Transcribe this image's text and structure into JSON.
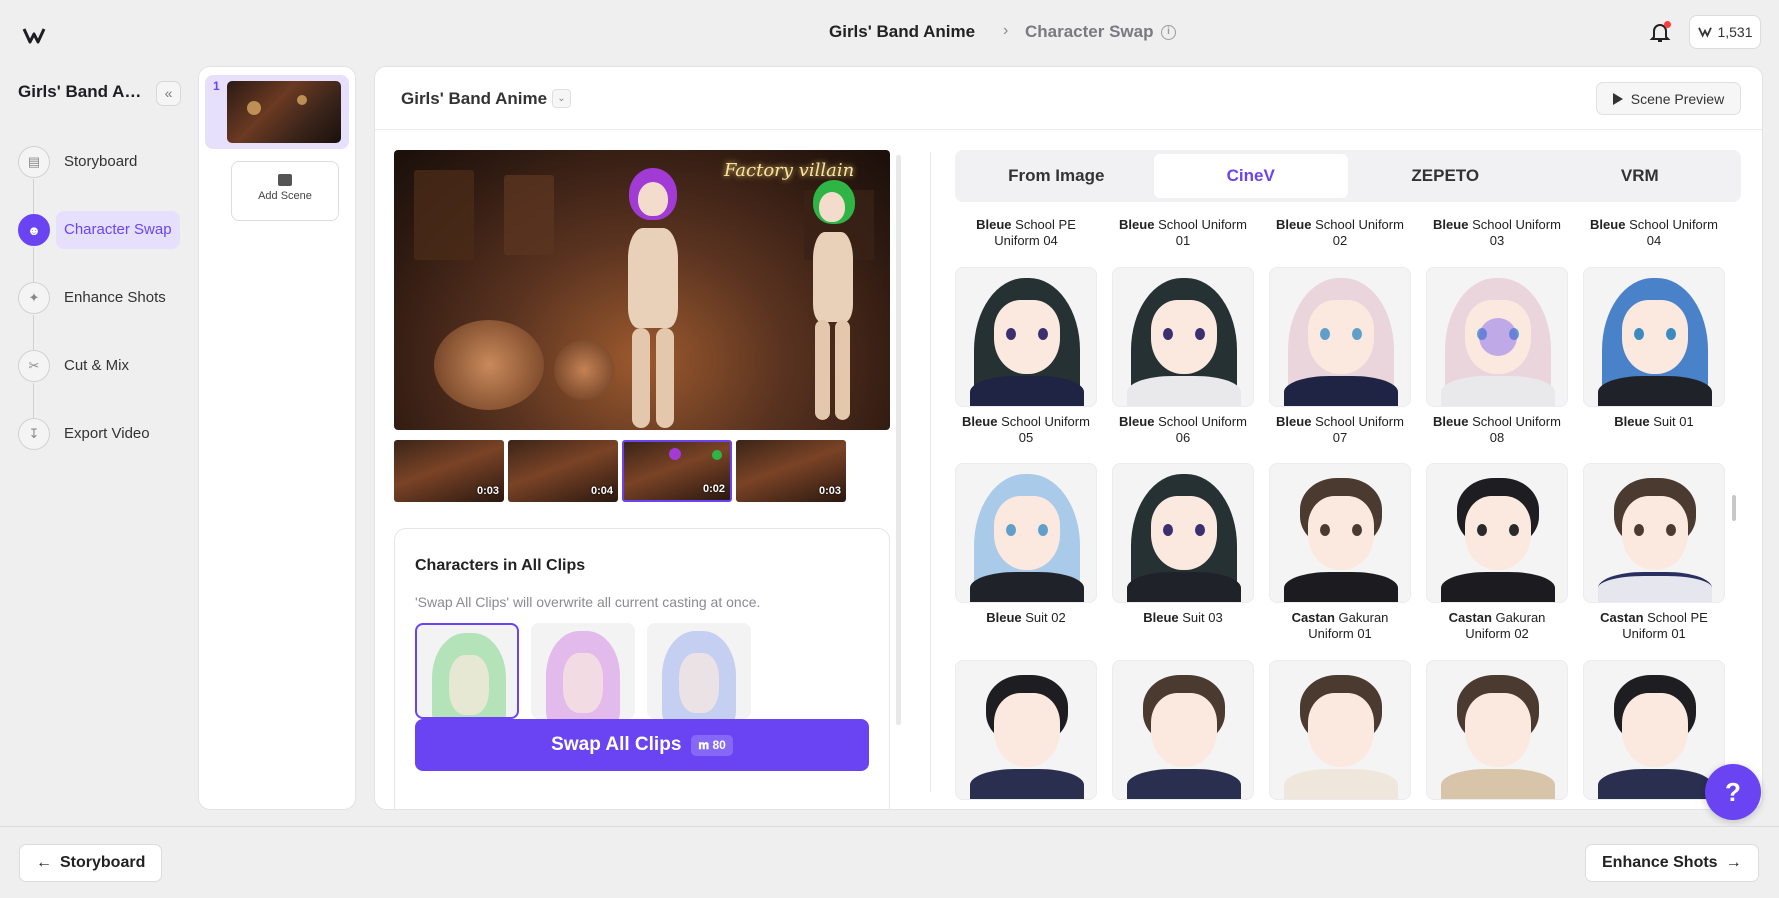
{
  "app": {
    "logo": "vivid-logo"
  },
  "header": {
    "project_title": "Girls' Band Anime",
    "separator": "›",
    "page": "Character Swap",
    "info": "i",
    "credits": "1,531"
  },
  "sidebar": {
    "project_name": "Girls' Band Ani...",
    "collapse": "«",
    "items": [
      {
        "label": "Storyboard",
        "icon": "storyboard-icon"
      },
      {
        "label": "Character Swap",
        "icon": "users-icon",
        "active": true
      },
      {
        "label": "Enhance Shots",
        "icon": "sparkle-icon"
      },
      {
        "label": "Cut & Mix",
        "icon": "scissors-icon"
      },
      {
        "label": "Export Video",
        "icon": "download-icon"
      }
    ]
  },
  "scenes": {
    "items": [
      {
        "number": "1"
      }
    ],
    "add_label": "Add Scene"
  },
  "main": {
    "title": "Girls' Band Anime",
    "dropdown": "⌄",
    "preview_label": "Scene Preview",
    "video_sign": "Factory villain",
    "clips": [
      {
        "duration": "0:03"
      },
      {
        "duration": "0:04"
      },
      {
        "duration": "0:02",
        "selected": true
      },
      {
        "duration": "0:03"
      }
    ],
    "characters": {
      "title": "Characters in All Clips",
      "note": "'Swap All Clips' will overwrite all current casting at once.",
      "swap_label": "Swap All Clips",
      "swap_cost": "80"
    }
  },
  "tabs": [
    {
      "label": "From Image"
    },
    {
      "label": "CineV",
      "active": true
    },
    {
      "label": "ZEPETO"
    },
    {
      "label": "VRM"
    }
  ],
  "grid": {
    "row0": [
      {
        "brand": "Bleue",
        "name": "School PE Uniform 04"
      },
      {
        "brand": "Bleue",
        "name": "School Uniform 01"
      },
      {
        "brand": "Bleue",
        "name": "School Uniform 02"
      },
      {
        "brand": "Bleue",
        "name": "School Uniform 03"
      },
      {
        "brand": "Bleue",
        "name": "School Uniform 04"
      }
    ],
    "row1": [
      {
        "brand": "Bleue",
        "name": "School Uniform 05"
      },
      {
        "brand": "Bleue",
        "name": "School Uniform 06"
      },
      {
        "brand": "Bleue",
        "name": "School Uniform 07"
      },
      {
        "brand": "Bleue",
        "name": "School Uniform 08"
      },
      {
        "brand": "Bleue",
        "name": "Suit 01"
      }
    ],
    "row2": [
      {
        "brand": "Bleue",
        "name": "Suit 02"
      },
      {
        "brand": "Bleue",
        "name": "Suit 03"
      },
      {
        "brand": "Castan",
        "name": "Gakuran Uniform 01"
      },
      {
        "brand": "Castan",
        "name": "Gakuran Uniform 02"
      },
      {
        "brand": "Castan",
        "name": "School PE Uniform 01"
      }
    ]
  },
  "footer": {
    "back_label": "Storyboard",
    "next_label": "Enhance Shots"
  },
  "help": "?"
}
